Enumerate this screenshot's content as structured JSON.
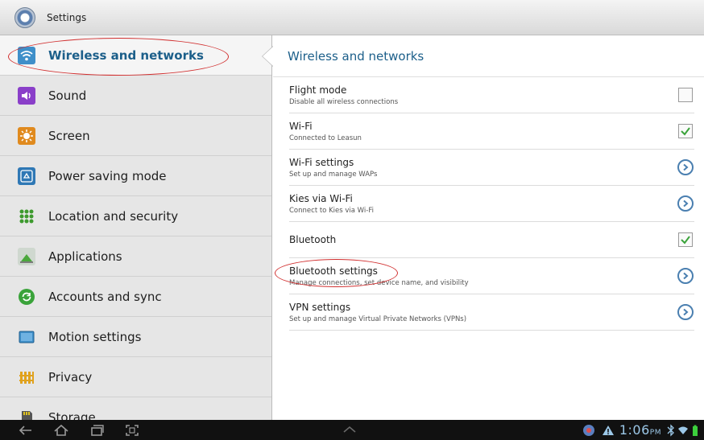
{
  "titlebar": {
    "title": "Settings",
    "icon": "settings-gear-icon"
  },
  "sidebar": {
    "items": [
      {
        "label": "Wireless and networks",
        "icon": "wifi-icon",
        "active": true
      },
      {
        "label": "Sound",
        "icon": "speaker-icon",
        "active": false
      },
      {
        "label": "Screen",
        "icon": "brightness-icon",
        "active": false
      },
      {
        "label": "Power saving mode",
        "icon": "recycle-icon",
        "active": false
      },
      {
        "label": "Location and security",
        "icon": "grid-dots-icon",
        "active": false
      },
      {
        "label": "Applications",
        "icon": "android-icon",
        "active": false
      },
      {
        "label": "Accounts and sync",
        "icon": "sync-icon",
        "active": false
      },
      {
        "label": "Motion settings",
        "icon": "tablet-icon",
        "active": false
      },
      {
        "label": "Privacy",
        "icon": "fence-icon",
        "active": false
      },
      {
        "label": "Storage",
        "icon": "sd-card-icon",
        "active": false
      }
    ]
  },
  "content": {
    "title": "Wireless and networks",
    "rows": [
      {
        "title": "Flight mode",
        "subtitle": "Disable all wireless connections",
        "control": "checkbox",
        "checked": false
      },
      {
        "title": "Wi-Fi",
        "subtitle": "Connected to Leasun",
        "control": "checkbox",
        "checked": true
      },
      {
        "title": "Wi-Fi settings",
        "subtitle": "Set up and manage WAPs",
        "control": "chevron"
      },
      {
        "title": "Kies via Wi-Fi",
        "subtitle": "Connect to Kies via Wi-Fi",
        "control": "chevron"
      },
      {
        "title": "Bluetooth",
        "subtitle": "",
        "control": "checkbox",
        "checked": true
      },
      {
        "title": "Bluetooth settings",
        "subtitle": "Manage connections, set device name, and visibility",
        "control": "chevron"
      },
      {
        "title": "VPN settings",
        "subtitle": "Set up and manage Virtual Private Networks (VPNs)",
        "control": "chevron"
      }
    ]
  },
  "statusbar": {
    "time": "1:06",
    "ampm": "PM",
    "nav_icons": [
      "back-icon",
      "home-icon",
      "recent-apps-icon",
      "screenshot-icon"
    ],
    "status_icons": [
      "notification-icon",
      "warning-icon",
      "bluetooth-icon",
      "wifi-signal-icon",
      "battery-icon"
    ]
  },
  "colors": {
    "accent": "#1c5f8a",
    "check": "#3aa33a",
    "annotation": "#d12f2f"
  }
}
